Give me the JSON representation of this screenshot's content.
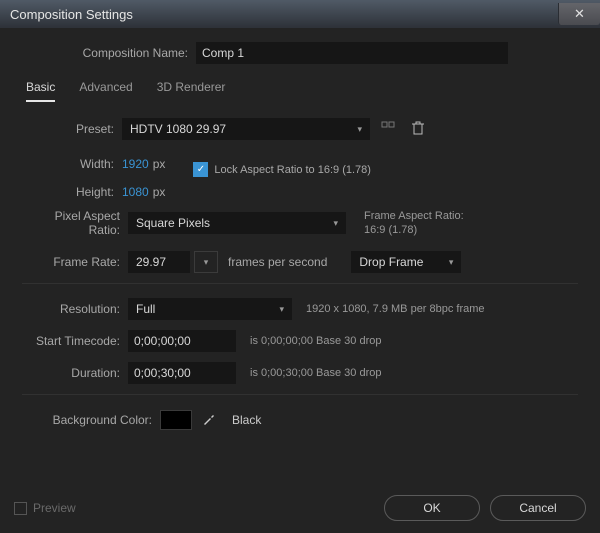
{
  "window": {
    "title": "Composition Settings"
  },
  "compName": {
    "label": "Composition Name:",
    "value": "Comp 1"
  },
  "tabs": {
    "basic": "Basic",
    "advanced": "Advanced",
    "renderer": "3D Renderer"
  },
  "preset": {
    "label": "Preset:",
    "value": "HDTV 1080 29.97"
  },
  "width": {
    "label": "Width:",
    "value": "1920",
    "unit": "px"
  },
  "height": {
    "label": "Height:",
    "value": "1080",
    "unit": "px"
  },
  "lockAspect": {
    "label": "Lock Aspect Ratio to 16:9 (1.78)"
  },
  "pixelAspect": {
    "label": "Pixel Aspect Ratio:",
    "value": "Square Pixels"
  },
  "frameAspect": {
    "line1": "Frame Aspect Ratio:",
    "line2": "16:9 (1.78)"
  },
  "frameRate": {
    "label": "Frame Rate:",
    "value": "29.97",
    "unit": "frames per second",
    "drop": "Drop Frame"
  },
  "resolution": {
    "label": "Resolution:",
    "value": "Full",
    "info": "1920 x 1080, 7.9 MB per 8bpc frame"
  },
  "startTimecode": {
    "label": "Start Timecode:",
    "value": "0;00;00;00",
    "info": "is 0;00;00;00 Base 30 drop"
  },
  "duration": {
    "label": "Duration:",
    "value": "0;00;30;00",
    "info": "is 0;00;30;00 Base 30 drop"
  },
  "bgColor": {
    "label": "Background Color:",
    "name": "Black"
  },
  "footer": {
    "preview": "Preview",
    "ok": "OK",
    "cancel": "Cancel"
  }
}
